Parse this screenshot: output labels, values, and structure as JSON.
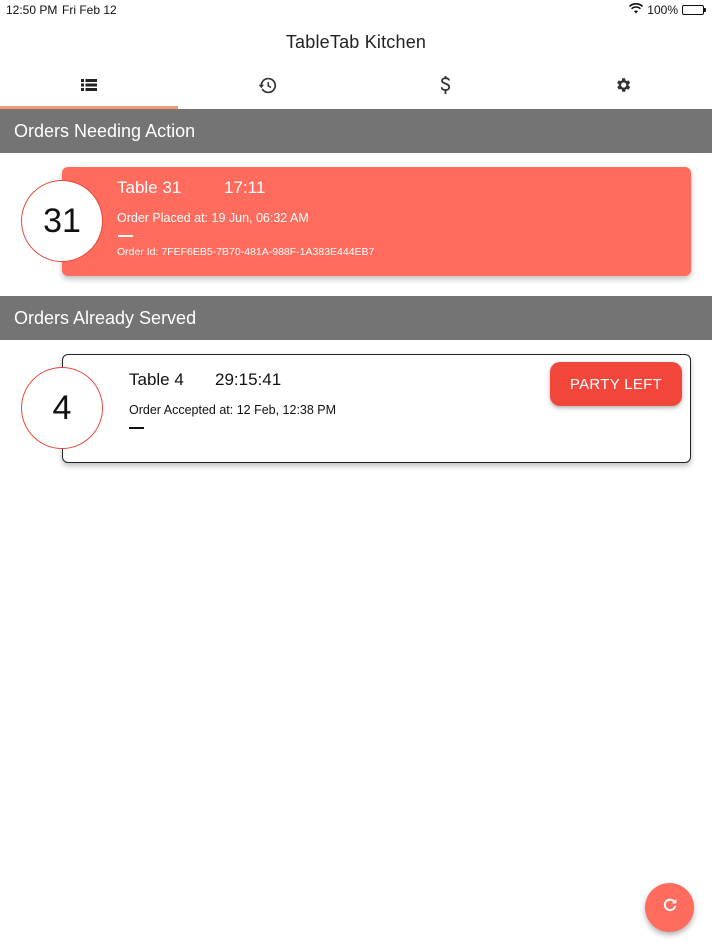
{
  "status_bar": {
    "time": "12:50 PM",
    "date": "Fri Feb 12",
    "battery": "100%"
  },
  "app": {
    "title": "TableTab Kitchen"
  },
  "tabs": [
    {
      "icon": "list-icon",
      "active": true
    },
    {
      "icon": "history-icon",
      "active": false
    },
    {
      "icon": "dollar-icon",
      "active": false
    },
    {
      "icon": "gear-icon",
      "active": false
    }
  ],
  "sections": {
    "needing_action": {
      "title": "Orders Needing Action",
      "orders": [
        {
          "table_number": "31",
          "table_label": "Table 31",
          "timer": "17:11",
          "placed": "Order Placed at: 19 Jun, 06:32 AM",
          "order_id": "Order Id: 7FEF6EB5-7B70-481A-988F-1A383E444EB7"
        }
      ]
    },
    "served": {
      "title": "Orders Already Served",
      "orders": [
        {
          "table_number": "4",
          "table_label": "Table 4",
          "timer": "29:15:41",
          "accepted": "Order Accepted at: 12 Feb, 12:38 PM",
          "button_label": "PARTY LEFT"
        }
      ]
    }
  },
  "colors": {
    "accent": "#ff6b5d",
    "button": "#f2463a",
    "header_bg": "#747474",
    "tab_indicator": "#f29a78"
  }
}
